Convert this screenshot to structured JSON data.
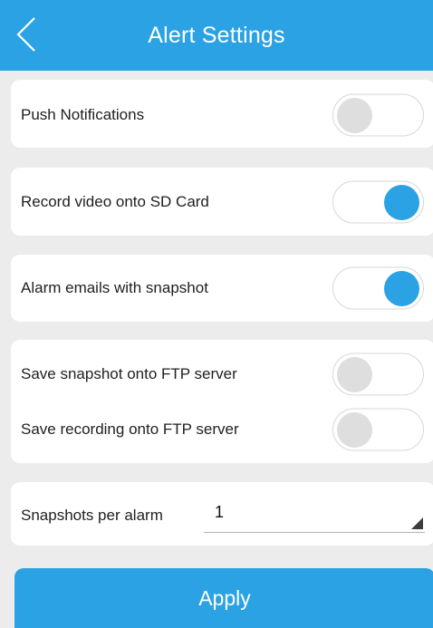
{
  "header": {
    "title": "Alert Settings",
    "back_icon": "chevron-left-icon"
  },
  "settings": {
    "push_notifications": {
      "label": "Push Notifications",
      "enabled": false
    },
    "record_sd": {
      "label": "Record video onto SD Card",
      "enabled": true
    },
    "alarm_emails": {
      "label": "Alarm emails with snapshot",
      "enabled": true
    },
    "ftp_snapshot": {
      "label": "Save snapshot onto FTP server",
      "enabled": false
    },
    "ftp_recording": {
      "label": "Save recording onto FTP server",
      "enabled": false
    },
    "snapshots_per_alarm": {
      "label": "Snapshots per alarm",
      "value": "1"
    }
  },
  "apply_label": "Apply",
  "colors": {
    "accent": "#2ba2e3",
    "background": "#ececec",
    "card": "#ffffff",
    "toggle_off_knob": "#dedede"
  }
}
